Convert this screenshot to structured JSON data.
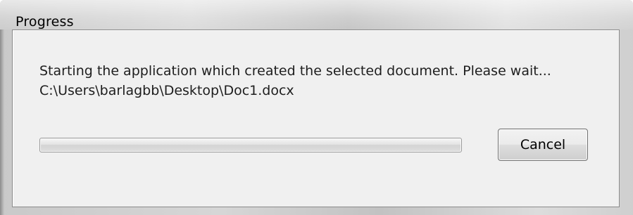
{
  "window": {
    "title": "Progress"
  },
  "dialog": {
    "message_line1": "Starting the application which created the selected document. Please wait...",
    "message_line2": "C:\\Users\\barlagbb\\Desktop\\Doc1.docx",
    "progress_fraction": 0.0,
    "cancel_label": "Cancel"
  },
  "colors": {
    "client_background": "#f0f0f0",
    "titlebar_glass": "#d4d4d4",
    "text": "#1e1e1e",
    "progress_fill": "#42b51f"
  }
}
